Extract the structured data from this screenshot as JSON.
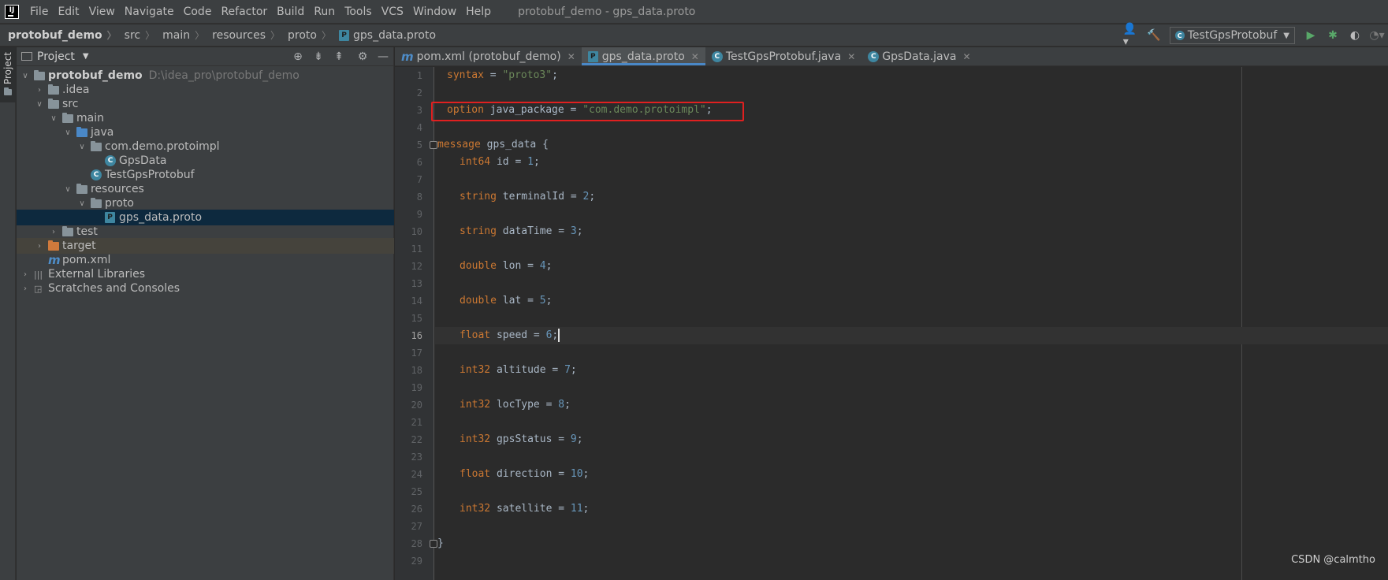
{
  "app": {
    "menu": [
      "File",
      "Edit",
      "View",
      "Navigate",
      "Code",
      "Refactor",
      "Build",
      "Run",
      "Tools",
      "VCS",
      "Window",
      "Help"
    ],
    "window_title": "protobuf_demo - gps_data.proto",
    "logo": "IJ"
  },
  "breadcrumb": [
    "protobuf_demo",
    "src",
    "main",
    "resources",
    "proto",
    "gps_data.proto"
  ],
  "run_config": "TestGpsProtobuf",
  "project_panel": {
    "title": "Project",
    "stripe_label": "Project",
    "root_name": "protobuf_demo",
    "root_path": "D:\\idea_pro\\protobuf_demo",
    "items": [
      {
        "label": ".idea"
      },
      {
        "label": "src"
      },
      {
        "label": "main"
      },
      {
        "label": "java"
      },
      {
        "label": "com.demo.protoimpl"
      },
      {
        "label": "GpsData"
      },
      {
        "label": "TestGpsProtobuf"
      },
      {
        "label": "resources"
      },
      {
        "label": "proto"
      },
      {
        "label": "gps_data.proto"
      },
      {
        "label": "test"
      },
      {
        "label": "target"
      },
      {
        "label": "pom.xml"
      },
      {
        "label": "External Libraries"
      },
      {
        "label": "Scratches and Consoles"
      }
    ]
  },
  "tabs": [
    {
      "label": "pom.xml (protobuf_demo)",
      "active": false
    },
    {
      "label": "gps_data.proto",
      "active": true
    },
    {
      "label": "TestGpsProtobuf.java",
      "active": false
    },
    {
      "label": "GpsData.java",
      "active": false
    }
  ],
  "editor": {
    "line_numbers": [
      "1",
      "2",
      "3",
      "4",
      "5",
      "6",
      "7",
      "8",
      "9",
      "10",
      "11",
      "12",
      "13",
      "14",
      "15",
      "16",
      "17",
      "18",
      "19",
      "20",
      "21",
      "22",
      "23",
      "24",
      "25",
      "26",
      "27",
      "28",
      "29"
    ],
    "current_line": "16",
    "code": {
      "l1_kw": "syntax",
      "l1_eq": " = ",
      "l1_str": "\"proto3\"",
      "l1_end": ";",
      "l3_kw": "option",
      "l3_mid": " java_package = ",
      "l3_str": "\"com.demo.protoimpl\"",
      "l3_end": ";",
      "l5_kw": "message",
      "l5_rest": " gps_data {",
      "fields": [
        {
          "type": "int64",
          "rest": " id = ",
          "num": "1"
        },
        {
          "type": "string",
          "rest": " terminalId = ",
          "num": "2"
        },
        {
          "type": "string",
          "rest": " dataTime = ",
          "num": "3"
        },
        {
          "type": "double",
          "rest": " lon = ",
          "num": "4"
        },
        {
          "type": "double",
          "rest": " lat = ",
          "num": "5"
        },
        {
          "type": "float",
          "rest": " speed = ",
          "num": "6"
        },
        {
          "type": "int32",
          "rest": " altitude = ",
          "num": "7"
        },
        {
          "type": "int32",
          "rest": " locType = ",
          "num": "8"
        },
        {
          "type": "int32",
          "rest": " gpsStatus = ",
          "num": "9"
        },
        {
          "type": "float",
          "rest": " direction = ",
          "num": "10"
        },
        {
          "type": "int32",
          "rest": " satellite = ",
          "num": "11"
        }
      ],
      "semicolon": ";",
      "l28_close": "}"
    }
  },
  "watermark": "CSDN @calmtho",
  "colors": {
    "keyword": "#cc7832",
    "string": "#6a8759",
    "number": "#6897bb",
    "highlight_box": "#e02020",
    "selection": "#0d293e"
  }
}
